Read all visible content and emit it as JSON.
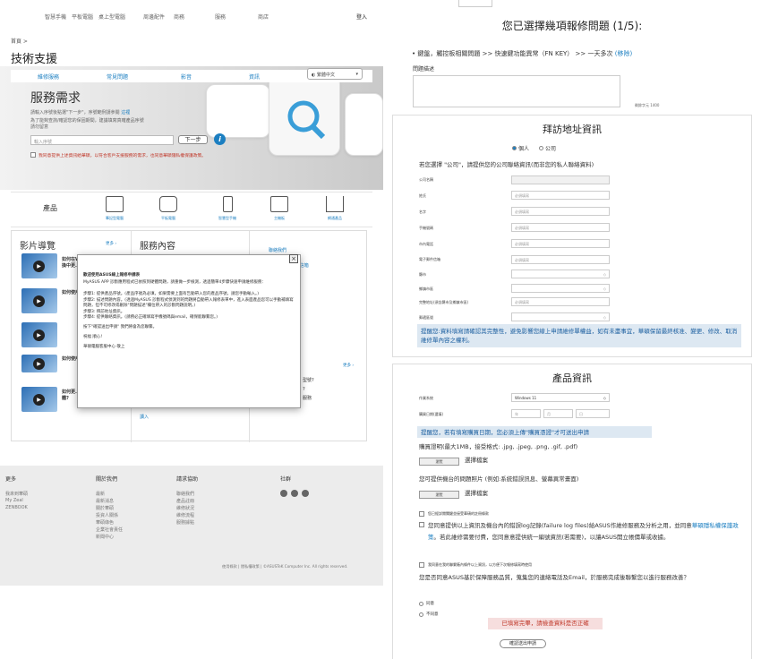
{
  "left": {
    "topnav": [
      "智慧手機",
      "平板電腦",
      "桌上型電腦",
      "周邊配件",
      "商務",
      "服務",
      "商店",
      "登入"
    ],
    "breadcrumb": "首頁 >",
    "page_title": "技術支援",
    "tabs": [
      "維修服務",
      "常見問題",
      "影音",
      "資訊"
    ],
    "lang": "繁體中文",
    "svc_title": "服務需求",
    "svc_desc1": "請輸入序號後點選\"下一步\"，序號範例請參閱",
    "svc_desc1_link": "這裡",
    "svc_desc2": "為了能夠查詢/確認您的保固期間，建議填寫真確產品序號",
    "svc_desc3": "請勿留意",
    "serial_placeholder": "輸入序號",
    "next_btn": "下一步",
    "agree_text": "我同意提供上述資訊給華碩，以符合客戶支援服務的需求，也同意華碩隱私權保護政策。",
    "products_label": "產品",
    "products": [
      "筆記型電腦",
      "平板電腦",
      "智慧型手機",
      "主機板",
      "網通產品"
    ],
    "videos_title": "影片導覽",
    "more": "更多 ›",
    "videos": [
      "如何在W...\n換中更...",
      "如何使用...",
      "如何使用...",
      "如何使用...\n器",
      "如何使用...",
      "如何更...\n體?"
    ],
    "service_title": "服務內容",
    "contact_title": "聯絡我們",
    "contact_items": [
      "門-客服信箱",
      "維修服務",
      "服務"
    ],
    "faq_items": [
      "型號?",
      "?",
      "服務"
    ],
    "modal": {
      "title": "歡迎使用ASUS線上報修申請表",
      "intro": "MyASUS APP 診斷應用程式已依照到硬體問題，請重做一步檢測，透過簡單4步驟快速申請維修服務：",
      "steps": [
        "步驟1: 提供產品序號。(產品序號為必填，如果需要上面有告動帶入您的產品序號，請您手動輸入。)",
        "步驟2: 描述問題內容。(透過MyASUS 診斷程式偵測到的問題將自動帶入報修表單中，進入表面產品您可以手動補填寫問題，但不可修改或刪除\"問題描述\"欄位帶入的診斷問題說明。)",
        "步驟3: 拜訪地址資訊。",
        "步驟4: 提供聯絡資訊。(請務必正確填寫手機號碼與email，確保能聯繫您。)"
      ],
      "hint": "按下\"確認送出申請\" 我們將會為您聯繫。",
      "thanks": "祝福 順心!",
      "sign": "華碩電腦客服中心 敬上"
    },
    "footer": {
      "cols": [
        "更多",
        "關於我們",
        "請求協助",
        "社群"
      ],
      "more_items": [
        "我來到華碩",
        "My Zeal",
        "ZENBOOK"
      ],
      "about_items": [
        "最新",
        "最新消息",
        "關於華碩",
        "投資人關係",
        "華碩綠色",
        "企業社會責任",
        "新聞中心"
      ],
      "help_items": [
        "聯絡我們",
        "產品註冊",
        "維修狀況",
        "維修流程",
        "服務據點"
      ],
      "legal": "使用條款 | 隱私權政策 | ©ASUSTeK Computer Inc. All rights reserved."
    }
  },
  "right": {
    "heading": "您已選擇幾項報修問題 (1/5):",
    "issue": "• 鍵盤，觸控板相關問題 >> 快速鍵功能異常（FN KEY） >> 一天多次",
    "remove": "(移除)",
    "desc_label": "問題描述",
    "char_count": "剩餘字元 1400",
    "address_title": "拜訪地址資訊",
    "personal": "個人",
    "company": "公司",
    "company_hint": "若您選擇 \"公司\"，請提供您的公司聯絡資訊(而非您的私人聯絡資料)",
    "fields": [
      "公司名稱",
      "姓氏",
      "名字",
      "手機號碼",
      "市內電話",
      "電子郵件信箱",
      "縣市",
      "鄉鎮市區",
      "完整地址(須含縣市及鄉鎮市區)",
      "郵遞區號"
    ],
    "required": "必須填寫",
    "reminder": "提醒您:資料填寫請確認其完整性，避免影響您線上申請維修單權益，如有未盡事宜，華碩保留最終核准、變更、修改、取消維修單內容之權利。",
    "product_title": "產品資訊",
    "os_label": "作業系統",
    "os_value": "Windows 11",
    "date_label": "購買日期(選填)",
    "date_parts": [
      "年",
      "月",
      "日"
    ],
    "purchase_notice": "提醒您，若有填寫購買日期，您必須上傳\"購買憑證\"才可送出申請",
    "proof_label": "購買證明(最大1MB，接受格式: .jpg, .jpeg, .png, .gif, .pdf)",
    "browse": "瀏覽",
    "choose_file": "選擇檔案",
    "photo_label": "您可提供機台的問題照片 (例如:系統錯誤訊息、螢幕異常畫面)",
    "check1": "您已經詳閱關鍵並接受華碩的註冊條款",
    "check2": "您同意提供以上資訊及機台內的錯誤log記錄(failure log files)給ASUS作維修服務及分析之用，並同意",
    "check2_link": "華碩隱私權保護政策",
    "check2_tail": "。若此維修需要付費，您同意意提供統一編號資訊(若需要)，以讓ASUS開立帳價單或收據。",
    "check3": "我同意在我的聯繫廠內條件以上資訊，以方便下次報修填寫時使用",
    "survey": "您是否同意ASUS基於保障服務品質，蒐集您的連絡電話及Email，於服務完成後聯繫您以進行服務改善？",
    "agree": "同意",
    "disagree": "不同意",
    "complete_notice": "已填寫完畢，請檢查資料是否正確",
    "submit": "確認送出申請"
  },
  "colors": {
    "link": "#1c7fc1",
    "alert": "#c0392b",
    "notice_bg": "#dde8f2"
  }
}
